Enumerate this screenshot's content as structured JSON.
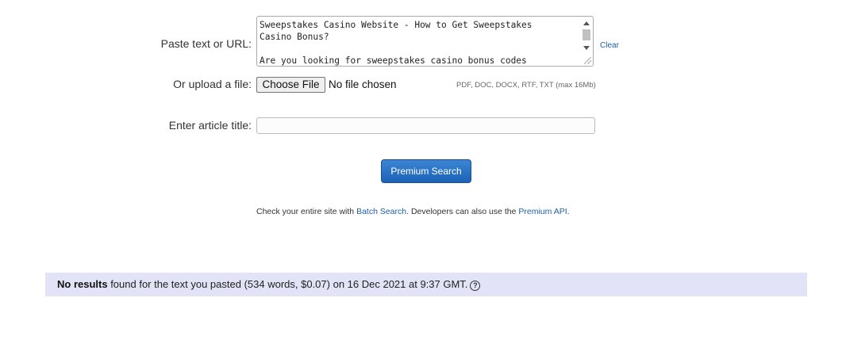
{
  "form": {
    "paste_label": "Paste text or URL:",
    "paste_text": "Sweepstakes Casino Website - How to Get Sweepstakes\nCasino Bonus?\n\nAre you looking for sweepstakes casino bonus codes",
    "clear_label": "Clear",
    "upload_label": "Or upload a file:",
    "choose_file_label": "Choose File",
    "file_status": "No file chosen",
    "file_hint": "PDF, DOC, DOCX, RTF, TXT (max 16Mb)",
    "title_label": "Enter article title:",
    "title_value": ""
  },
  "actions": {
    "search_label": "Premium Search"
  },
  "info": {
    "prefix": "Check your entire site with ",
    "batch_link": "Batch Search",
    "middle": ". Developers can also use the ",
    "api_link": "Premium API",
    "suffix": "."
  },
  "result": {
    "bold": "No results",
    "text": " found for the text you pasted (534 words, $0.07) on 16 Dec 2021 at 9:37 GMT.",
    "help_glyph": "?"
  }
}
